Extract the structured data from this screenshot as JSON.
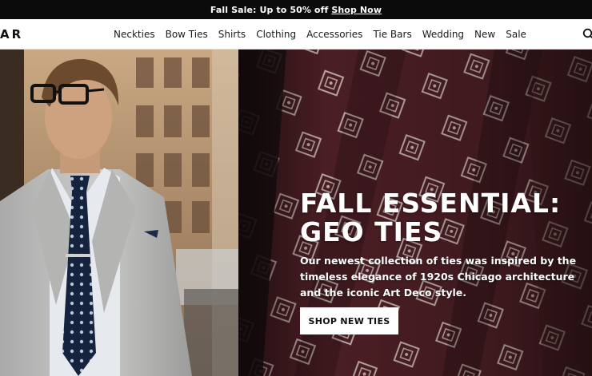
{
  "promo": {
    "text": "Fall Sale: Up to 50% off",
    "link": "Shop Now"
  },
  "header": {
    "logo": "AR",
    "nav": [
      "Neckties",
      "Bow Ties",
      "Shirts",
      "Clothing",
      "Accessories",
      "Tie Bars",
      "Wedding",
      "New",
      "Sale"
    ]
  },
  "hero": {
    "title": "FALL ESSENTIAL: GEO TIES",
    "description": "Our newest collection of ties was inspired by the timeless elegance of 1920s Chicago architecture and the iconic Art Deco style.",
    "cta": "SHOP NEW TIES"
  },
  "colors": {
    "promo_bg": "#0b0b0b",
    "tie_burgundy": "#4a1e24",
    "tie_navy": "#14233f",
    "suit_grey": "#b9bbbb"
  }
}
